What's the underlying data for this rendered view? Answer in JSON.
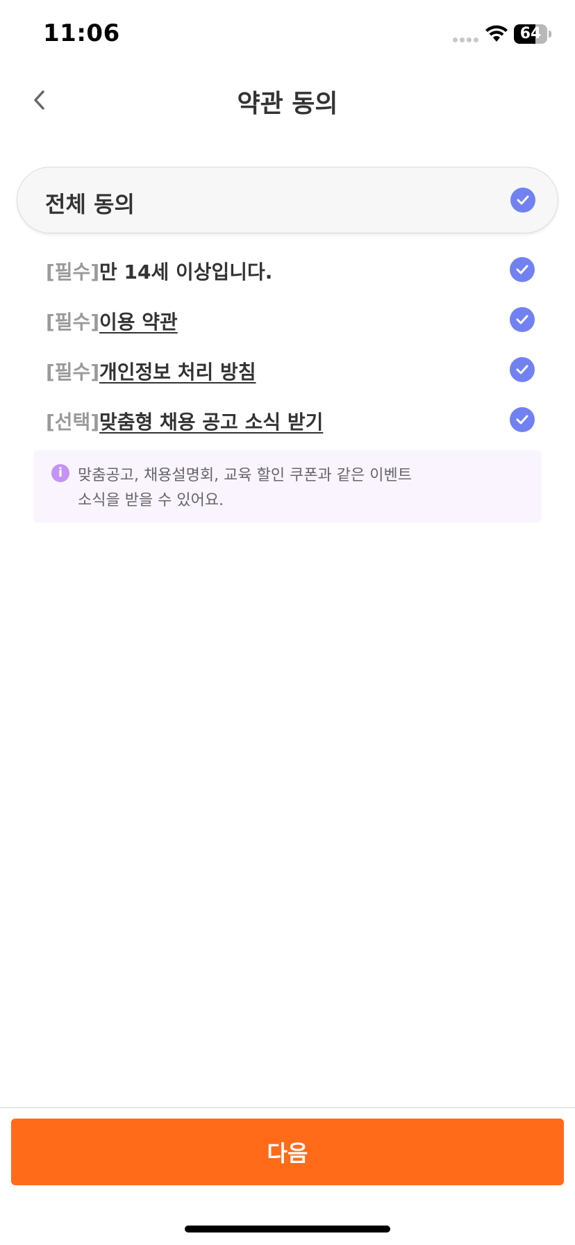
{
  "status_bar": {
    "time": "11:06",
    "battery_level": "64"
  },
  "header": {
    "title": "약관 동의",
    "back_icon": "chevron-left-icon"
  },
  "agree_all": {
    "label": "전체 동의",
    "checked": true
  },
  "terms": [
    {
      "tag": "[필수]",
      "text": "만 14세 이상입니다.",
      "link": false,
      "checked": true
    },
    {
      "tag": "[필수]",
      "text": "이용 약관",
      "link": true,
      "checked": true
    },
    {
      "tag": "[필수]",
      "text": "개인정보 처리 방침",
      "link": true,
      "checked": true
    },
    {
      "tag": "[선택]",
      "text": "맞춤형 채용 공고 소식 받기",
      "link": true,
      "checked": true
    }
  ],
  "info": {
    "icon": "info-icon",
    "icon_glyph": "i",
    "line1": "맞춤공고, 채용설명회, 교육 할인 쿠폰과 같은 이벤트",
    "line2": "소식을 받을 수 있어요."
  },
  "footer": {
    "next_label": "다음"
  },
  "colors": {
    "accent": "#ff6b18",
    "check": "#7281f2",
    "info_bg": "#f9f4ff",
    "info_icon": "#c493f5"
  }
}
